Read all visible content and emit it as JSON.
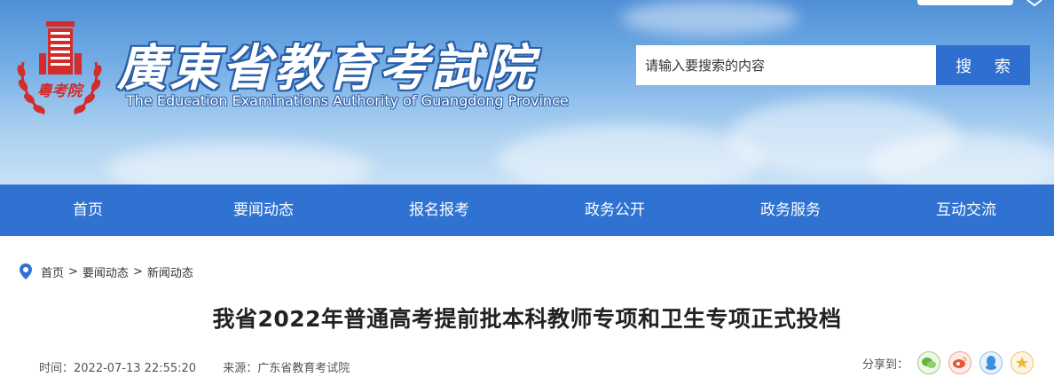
{
  "header": {
    "title_cn": "廣東省教育考試院",
    "title_en": "The Education Examinations Authority of Guangdong Province",
    "logo_text": "粵考院"
  },
  "search": {
    "placeholder": "请输入要搜索的内容",
    "button_label": "搜 索"
  },
  "nav": {
    "items": [
      {
        "label": "首页"
      },
      {
        "label": "要闻动态"
      },
      {
        "label": "报名报考"
      },
      {
        "label": "政务公开"
      },
      {
        "label": "政务服务"
      },
      {
        "label": "互动交流"
      }
    ]
  },
  "breadcrumb": {
    "items": [
      "首页",
      "要闻动态",
      "新闻动态"
    ],
    "separator": ">"
  },
  "article": {
    "title": "我省2022年普通高考提前批本科教师专项和卫生专项正式投档",
    "time_label": "时间：2022-07-13 22:55:20",
    "source_label": "来源：广东省教育考试院"
  },
  "share": {
    "label": "分享到：",
    "icons": [
      "wechat-icon",
      "weibo-icon",
      "qq-icon",
      "qzone-icon"
    ]
  },
  "colors": {
    "nav_bg": "#2f72d2",
    "search_button_bg": "#2f6fd0",
    "logo_red": "#d42b2b"
  }
}
